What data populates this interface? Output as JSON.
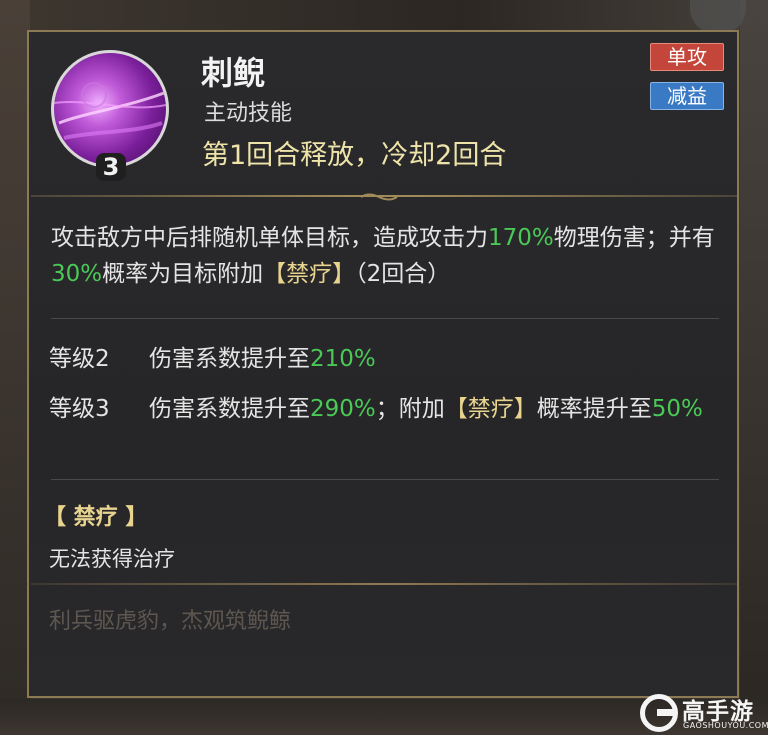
{
  "skill": {
    "name": "刺鲵",
    "type": "主动技能",
    "timing": "第1回合释放，冷却2回合",
    "level": "3",
    "icon": "purple-slash-icon"
  },
  "tags": {
    "target": "单攻",
    "effect": "减益"
  },
  "description": {
    "part1": "攻击敌方中后排随机单体目标，造成攻击力",
    "dmg": "170%",
    "part2": "物理伤害；并有",
    "chance": "30%",
    "part3": "概率为目标附加",
    "status": "【禁疗】",
    "part4": "（2回合）"
  },
  "levels": [
    {
      "label": "等级2",
      "prefix": "伤害系数提升至",
      "value": "210%"
    },
    {
      "label": "等级3",
      "prefix": "伤害系数提升至",
      "value": "290%",
      "mid": "；附加",
      "status": "【禁疗】",
      "mid2": "概率提升至",
      "value2": "50%"
    }
  ],
  "state": {
    "title": "【 禁疗 】",
    "desc": "无法获得治疗"
  },
  "flavor": "利兵驱虎豹，杰观筑鲵鲸",
  "watermark": {
    "main": "高手游",
    "sub": "GAOSHOUYOU.COM"
  },
  "colors": {
    "highlight": "#4ac956",
    "status": "#e8d48f",
    "tag_red": "#c4463a",
    "tag_blue": "#3a79c4",
    "border": "#8c7a55"
  }
}
